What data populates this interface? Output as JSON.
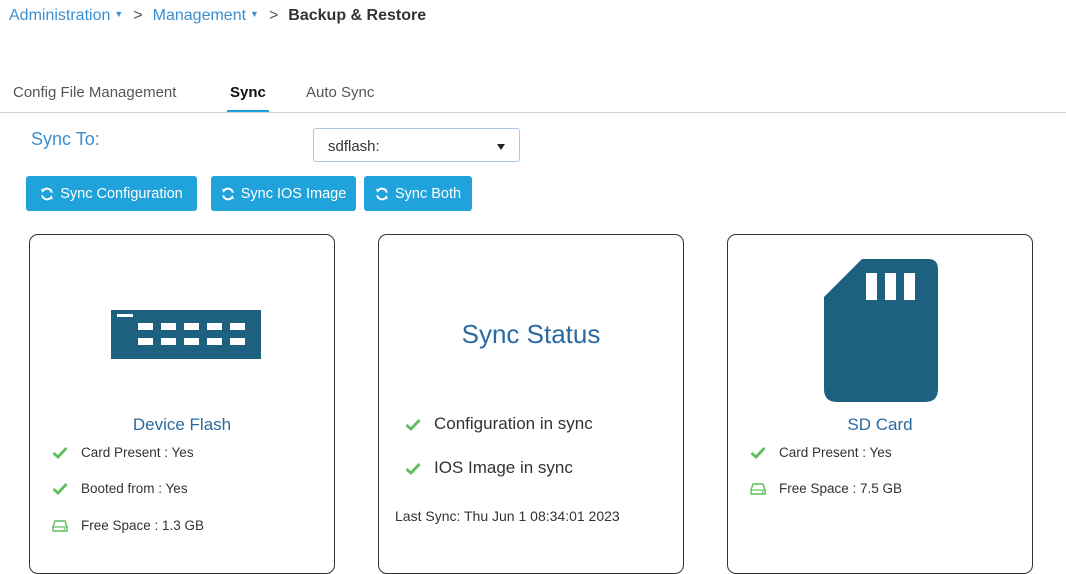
{
  "breadcrumb": {
    "items": [
      {
        "label": "Administration",
        "has_dropdown": true
      },
      {
        "label": "Management",
        "has_dropdown": true
      }
    ],
    "separator": ">",
    "current": "Backup & Restore"
  },
  "tabs": [
    {
      "label": "Config File Management",
      "active": false
    },
    {
      "label": "Sync",
      "active": true
    },
    {
      "label": "Auto Sync",
      "active": false
    }
  ],
  "sync_to": {
    "label": "Sync To:",
    "selected": "sdflash:"
  },
  "buttons": {
    "sync_configuration": "Sync Configuration",
    "sync_ios_image": "Sync IOS Image",
    "sync_both": "Sync Both"
  },
  "device_flash": {
    "title": "Device Flash",
    "icon": "device-flash-icon",
    "rows": [
      {
        "icon": "check-icon",
        "text": "Card Present : Yes"
      },
      {
        "icon": "check-icon",
        "text": "Booted from : Yes"
      },
      {
        "icon": "drive-icon",
        "text": "Free Space : 1.3 GB"
      }
    ]
  },
  "sync_status": {
    "title": "Sync Status",
    "rows": [
      {
        "icon": "check-icon",
        "text": "Configuration in sync"
      },
      {
        "icon": "check-icon",
        "text": "IOS Image in sync"
      }
    ],
    "last_sync": "Last Sync: Thu Jun 1 08:34:01 2023"
  },
  "sd_card": {
    "title": "SD Card",
    "icon": "sd-card-icon",
    "rows": [
      {
        "icon": "check-icon",
        "text": "Card Present : Yes"
      },
      {
        "icon": "drive-icon",
        "text": "Free Space : 7.5 GB"
      }
    ]
  },
  "colors": {
    "accent": "#1fa3da",
    "link": "#3b8fd0",
    "icon_dark": "#1d6080",
    "check": "#5cbf5c"
  }
}
